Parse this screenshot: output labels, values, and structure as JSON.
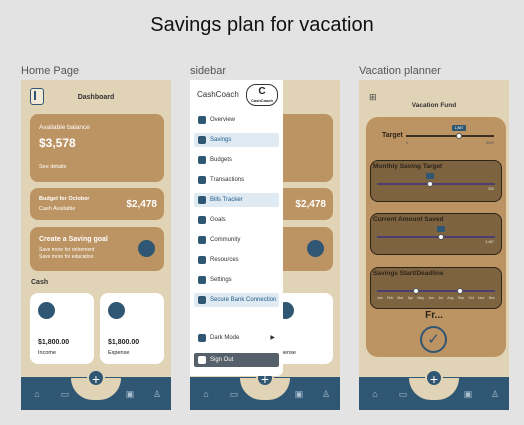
{
  "page_title": "Savings plan for vacation",
  "captions": {
    "home": "Home Page",
    "sidebar": "sidebar",
    "planner": "Vacation planner"
  },
  "home": {
    "header": "Dashboard",
    "balance": {
      "label": "Available balance",
      "amount": "$3,578",
      "details": "See details"
    },
    "budget": {
      "title": "Budget for October",
      "sub": "Cash Available",
      "amount": "$2,478"
    },
    "goal": {
      "title": "Create a Saving goal",
      "line1": "Save more for retirement",
      "line2": "Save more for education"
    },
    "cash_label": "Cash",
    "income": {
      "amount": "$1,800.00",
      "label": "Income"
    },
    "expense": {
      "amount": "$1,800.00",
      "label": "Expense"
    }
  },
  "sidebar": {
    "brand": "CashCoach",
    "logo_text": "CashCoach",
    "items": [
      "Overview",
      "Savings",
      "Budgets",
      "Transactions",
      "Bills Tracker",
      "Goals",
      "Community",
      "Resources",
      "Settings",
      "Secure Bank Connection"
    ],
    "dark_mode": "Dark Mode",
    "sign_out": "Sign Out",
    "behind_amount": "$2,478",
    "behind_expense": "pense"
  },
  "planner": {
    "title": "Vacation Fund",
    "target": "Target",
    "target_tip": "1,867",
    "target_min": "0",
    "target_max": "5000",
    "monthly": "Monthly Saving Target",
    "monthly_max": "300",
    "current": "Current Amount Saved",
    "current_max": "3,487",
    "dates": "Savings Start/Deadline",
    "months": [
      "Jan",
      "Feb",
      "Mar",
      "Apr",
      "May",
      "Jun",
      "Jul",
      "Aug",
      "Sep",
      "Oct",
      "Nov",
      "Dec"
    ],
    "fr": "Fr...",
    "target_fraction": 0.6,
    "monthly_fraction": 0.45,
    "current_fraction": 0.55
  },
  "colors": {
    "nav": "#2f5672",
    "card": "#bc9362",
    "phone_bg": "#e1d3b6",
    "slider_card": "#7d6340"
  }
}
